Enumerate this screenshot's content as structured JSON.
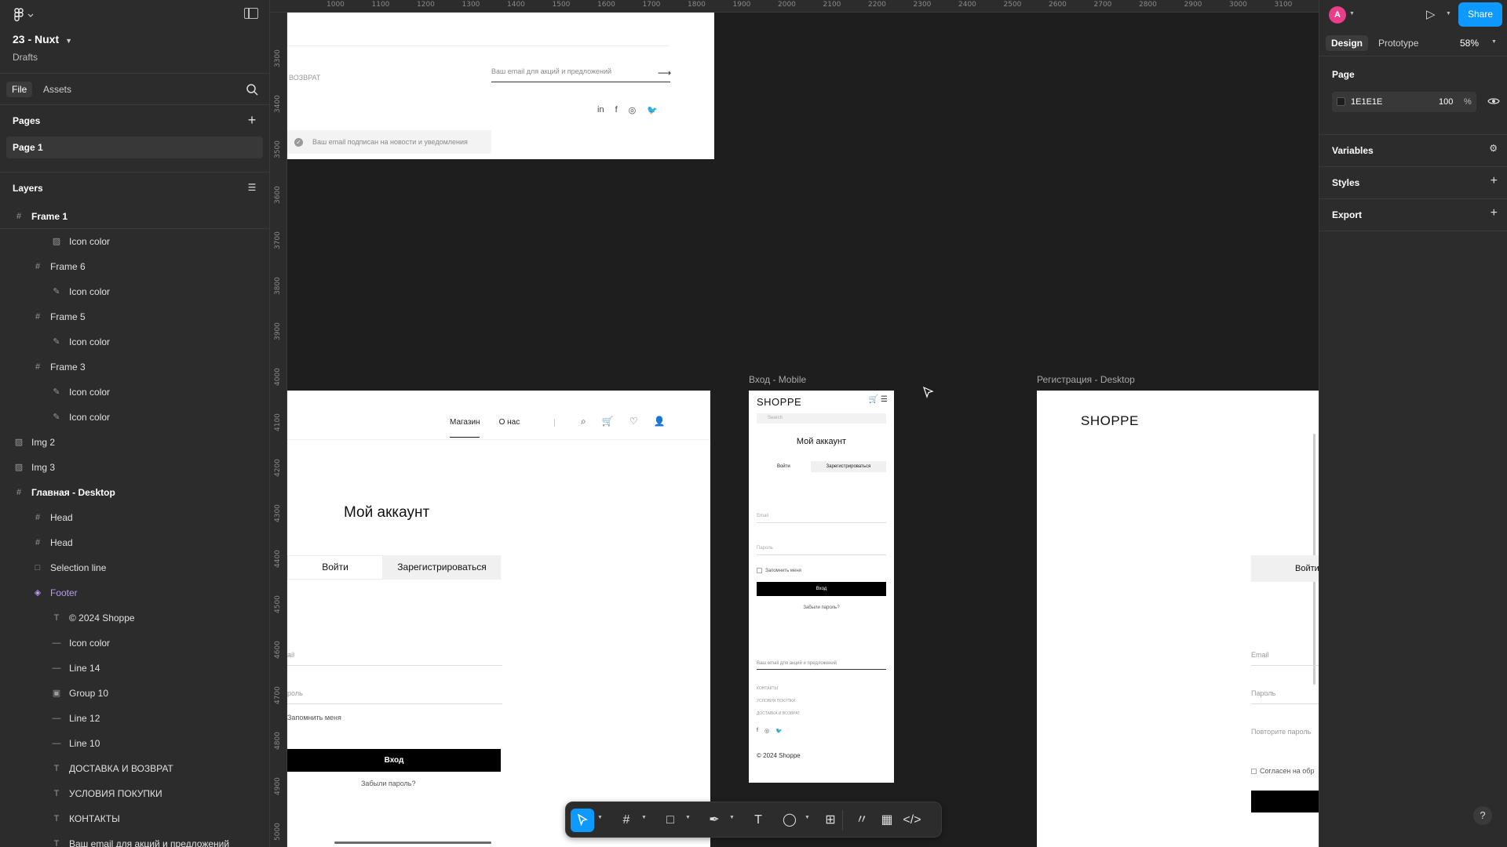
{
  "file": {
    "name": "23 - Nuxt",
    "location": "Drafts"
  },
  "left_tabs": {
    "file": "File",
    "assets": "Assets"
  },
  "pages": {
    "heading": "Pages",
    "items": [
      "Page 1"
    ]
  },
  "layers": {
    "heading": "Layers",
    "items": [
      {
        "label": "Frame 1",
        "icon": "frame-icon",
        "depth": 0,
        "bold": true
      },
      {
        "label": "Icon color",
        "icon": "image-icon",
        "depth": 2
      },
      {
        "label": "Frame 6",
        "icon": "frame-icon",
        "depth": 1
      },
      {
        "label": "Icon color",
        "icon": "vector-icon",
        "depth": 2
      },
      {
        "label": "Frame 5",
        "icon": "frame-icon",
        "depth": 1
      },
      {
        "label": "Icon color",
        "icon": "vector-icon",
        "depth": 2
      },
      {
        "label": "Frame 3",
        "icon": "frame-icon",
        "depth": 1
      },
      {
        "label": "Icon color",
        "icon": "vector-icon",
        "depth": 2
      },
      {
        "label": "Icon color",
        "icon": "vector-icon",
        "depth": 2
      },
      {
        "label": "Img 2",
        "icon": "image-icon",
        "depth": 0
      },
      {
        "label": "Img 3",
        "icon": "image-icon",
        "depth": 0
      },
      {
        "label": "Главная - Desktop",
        "icon": "frame-icon",
        "depth": 0,
        "bold": true
      },
      {
        "label": "Head",
        "icon": "frame-icon",
        "depth": 1
      },
      {
        "label": "Head",
        "icon": "frame-icon",
        "depth": 1
      },
      {
        "label": "Selection line",
        "icon": "rectangle-icon",
        "depth": 1
      },
      {
        "label": "Footer",
        "icon": "component-icon",
        "depth": 1,
        "purple": true
      },
      {
        "label": "© 2024 Shoppe",
        "icon": "text-icon",
        "depth": 2
      },
      {
        "label": "Icon color",
        "icon": "line-icon",
        "depth": 2
      },
      {
        "label": "Line 14",
        "icon": "line-icon",
        "depth": 2
      },
      {
        "label": "Group 10",
        "icon": "group-icon",
        "depth": 2
      },
      {
        "label": "Line 12",
        "icon": "line-icon",
        "depth": 2
      },
      {
        "label": "Line 10",
        "icon": "line-icon",
        "depth": 2
      },
      {
        "label": "ДОСТАВКА И ВОЗВРАТ",
        "icon": "text-icon",
        "depth": 2
      },
      {
        "label": "УСЛОВИЯ ПОКУПКИ",
        "icon": "text-icon",
        "depth": 2
      },
      {
        "label": "КОНТАКТЫ",
        "icon": "text-icon",
        "depth": 2
      },
      {
        "label": "Ваш email для акций и предложений",
        "icon": "text-icon",
        "depth": 2
      }
    ]
  },
  "ruler_top": [
    "1000",
    "1100",
    "1200",
    "1300",
    "1400",
    "1500",
    "1600",
    "1700",
    "1800",
    "1900",
    "2000",
    "2100",
    "2200",
    "2300",
    "2400",
    "2500",
    "2600",
    "2700",
    "2800",
    "2900",
    "3000",
    "3100"
  ],
  "ruler_left": [
    "3300",
    "3400",
    "3500",
    "3600",
    "3700",
    "3800",
    "3900",
    "4000",
    "4100",
    "4200",
    "4300",
    "4400",
    "4500",
    "4600",
    "4700",
    "4800",
    "4900",
    "5000"
  ],
  "footer_frame": {
    "vozvrat": "ВОЗВРАТ",
    "email_placeholder": "Ваш email для акций и предложений",
    "arrow": "⟶",
    "socials": [
      "in",
      "f",
      "◎",
      "🐦"
    ],
    "toast": "Ваш email подписан на новости и уведомления"
  },
  "account_frame": {
    "nav": [
      "Магазин",
      "О нас"
    ],
    "title": "Мой аккаунт",
    "tab_login": "Войти",
    "tab_register": "Зарегистрироваться",
    "email_label": "ail",
    "password_label": "роль",
    "remember": "Запомнить меня",
    "button": "Вход",
    "forgot": "Забыли пароль?"
  },
  "mobile_frame": {
    "label": "Вход - Mobile",
    "logo": "SHOPPE",
    "search": "Search",
    "title": "Мой аккаунт",
    "tab_login": "Войти",
    "tab_register": "Зарегистрироваться",
    "email": "Email",
    "password": "Пароль",
    "remember": "Запомнить меня",
    "button": "Вход",
    "forgot": "Забыли пароль?",
    "email_sub": "Ваш email для акций и предложений",
    "links": [
      "КОНТАКТЫ",
      "УСЛОВИЯ ПОКУПКИ",
      "ДОСТАВКА И ВОЗВРАТ"
    ],
    "socials": [
      "f",
      "◎",
      "🐦"
    ],
    "copyright": "© 2024 Shoppe"
  },
  "register_frame": {
    "label": "Регистрация - Desktop",
    "logo": "SHOPPE",
    "tab": "Войти",
    "email": "Email",
    "password": "Пароль",
    "repeat": "Повторите пароль",
    "agree": "Согласен на обр"
  },
  "right_panel": {
    "avatar": "A",
    "share": "Share",
    "tabs": {
      "design": "Design",
      "prototype": "Prototype"
    },
    "zoom": "58%",
    "page_heading": "Page",
    "bg_color": "1E1E1E",
    "bg_opacity": "100",
    "pct": "%",
    "variables": "Variables",
    "styles": "Styles",
    "export": "Export",
    "help": "?"
  },
  "colors": {
    "accent": "#0d99ff",
    "canvas": "#1e1e1e",
    "panel": "#2c2c2c",
    "avatar": "#e83e8c"
  }
}
